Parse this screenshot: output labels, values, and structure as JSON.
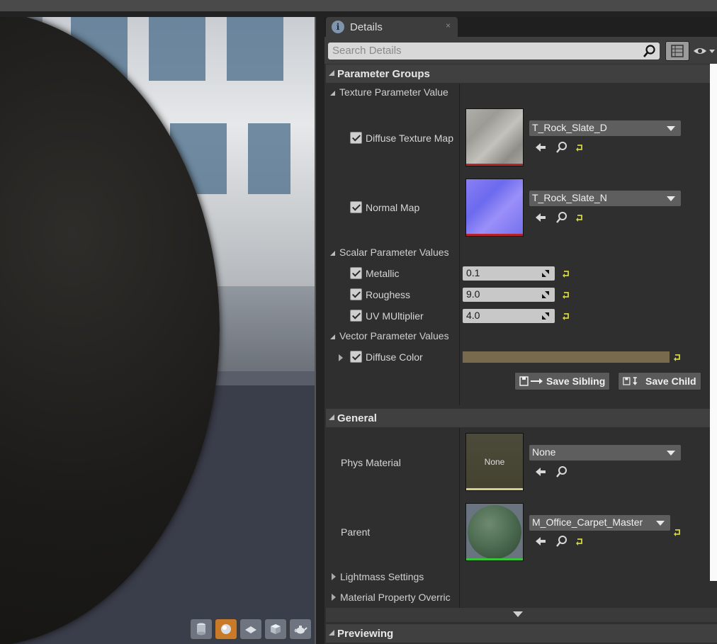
{
  "details_tab": {
    "title": "Details",
    "close": "×"
  },
  "search": {
    "placeholder": "Search Details"
  },
  "sections": {
    "parameter_groups": "Parameter Groups",
    "general": "General",
    "previewing": "Previewing"
  },
  "groups": {
    "texture": "Texture Parameter Value",
    "scalar": "Scalar Parameter Values",
    "vector": "Vector Parameter Values",
    "lightmass": "Lightmass Settings",
    "material_override": "Material Property Overric"
  },
  "texture_params": [
    {
      "label": "Diffuse Texture Map",
      "asset": "T_Rock_Slate_D",
      "checked": true
    },
    {
      "label": "Normal Map",
      "asset": "T_Rock_Slate_N",
      "checked": true
    }
  ],
  "scalar_params": [
    {
      "label": "Metallic",
      "value": "0.1",
      "checked": true
    },
    {
      "label": "Roughess",
      "value": "9.0",
      "checked": true
    },
    {
      "label": "UV MUltiplier",
      "value": "4.0",
      "checked": true
    }
  ],
  "vector_params": [
    {
      "label": "Diffuse Color",
      "color": "#786a4d",
      "checked": true
    }
  ],
  "buttons": {
    "save_sibling": "Save Sibling",
    "save_child": "Save Child"
  },
  "general": {
    "phys_material": {
      "label": "Phys Material",
      "value": "None",
      "thumb_text": "None"
    },
    "parent": {
      "label": "Parent",
      "value": "M_Office_Carpet_Master"
    }
  },
  "icons": {
    "viewport_tools": [
      "cylinder-icon",
      "sphere-icon",
      "plane-icon",
      "cube-icon",
      "teapot-icon"
    ],
    "active_tool": "sphere-icon"
  },
  "colors": {
    "accent": "#c97a28",
    "reset_arrow": "#d6d63a",
    "diffuse_color": "#786a4d"
  }
}
